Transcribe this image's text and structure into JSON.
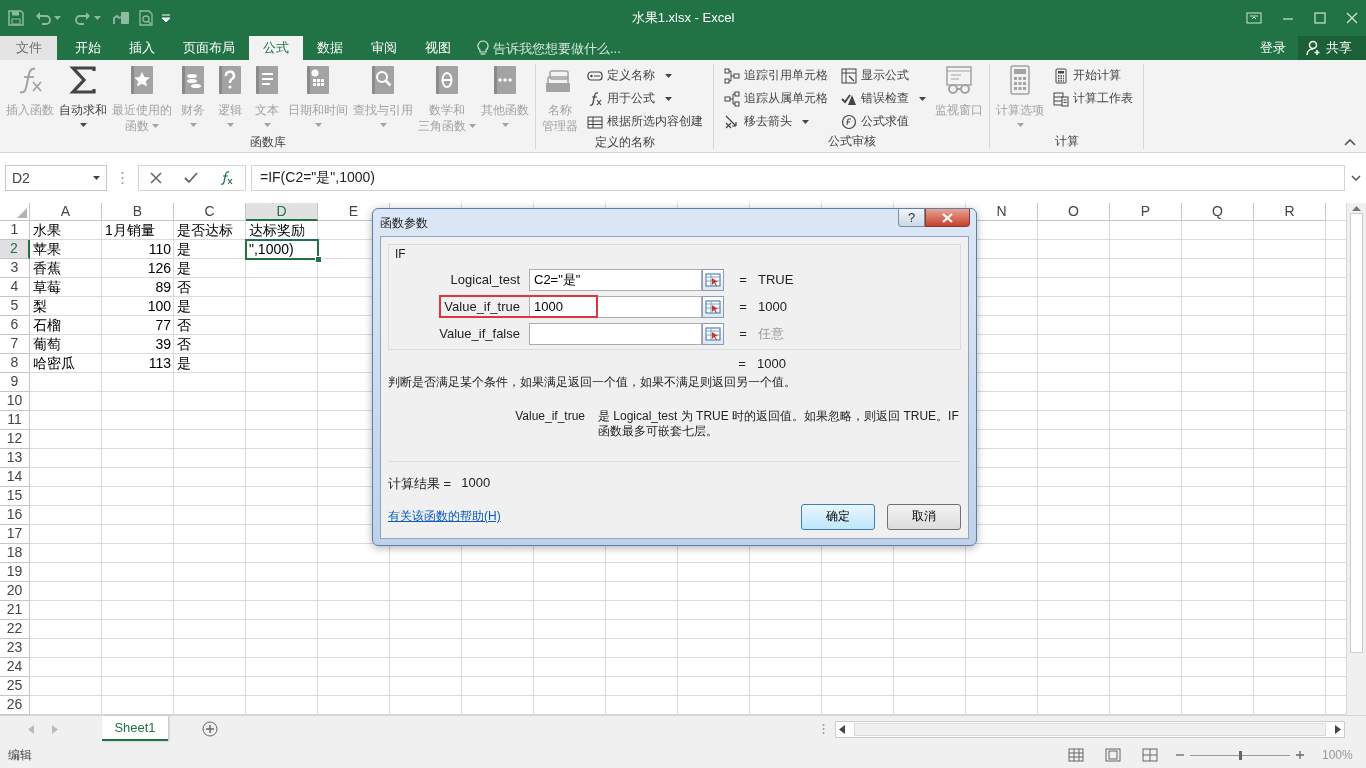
{
  "window": {
    "title": "水果1.xlsx - Excel"
  },
  "tabs": [
    {
      "label": "文件",
      "kind": "file",
      "selected": false
    },
    {
      "label": "开始",
      "kind": "tab",
      "selected": false
    },
    {
      "label": "插入",
      "kind": "tab",
      "selected": false
    },
    {
      "label": "页面布局",
      "kind": "tab",
      "selected": false
    },
    {
      "label": "公式",
      "kind": "tab",
      "selected": true
    },
    {
      "label": "数据",
      "kind": "tab",
      "selected": false
    },
    {
      "label": "审阅",
      "kind": "tab",
      "selected": false
    },
    {
      "label": "视图",
      "kind": "tab",
      "selected": false
    }
  ],
  "tell_me": {
    "placeholder": "告诉我您想要做什么..."
  },
  "account": {
    "sign_in": "登录",
    "share": "共享"
  },
  "ribbon": {
    "groups": [
      {
        "label": "函数库",
        "items": [
          {
            "kind": "large",
            "lines": [
              "插入函数"
            ],
            "disabled": true,
            "dropdown": false
          },
          {
            "kind": "large",
            "lines": [
              "自动求和"
            ],
            "disabled": false,
            "dropdown": true
          },
          {
            "kind": "large",
            "lines": [
              "最近使用的",
              "函数"
            ],
            "disabled": true,
            "dropdown": true
          },
          {
            "kind": "large",
            "lines": [
              "财务"
            ],
            "disabled": true,
            "dropdown": true
          },
          {
            "kind": "large",
            "lines": [
              "逻辑"
            ],
            "disabled": true,
            "dropdown": true
          },
          {
            "kind": "large",
            "lines": [
              "文本"
            ],
            "disabled": true,
            "dropdown": true
          },
          {
            "kind": "large",
            "lines": [
              "日期和时间"
            ],
            "disabled": true,
            "dropdown": true
          },
          {
            "kind": "large",
            "lines": [
              "查找与引用"
            ],
            "disabled": true,
            "dropdown": true
          },
          {
            "kind": "large",
            "lines": [
              "数学和",
              "三角函数"
            ],
            "disabled": true,
            "dropdown": true
          },
          {
            "kind": "large",
            "lines": [
              "其他函数"
            ],
            "disabled": true,
            "dropdown": true
          }
        ]
      },
      {
        "label": "定义的名称",
        "items": [
          {
            "kind": "large",
            "lines": [
              "名称",
              "管理器"
            ],
            "disabled": true,
            "dropdown": false
          },
          {
            "kind": "stack",
            "items": [
              {
                "label": "定义名称",
                "disabled": true,
                "dropdown": true
              },
              {
                "label": "用于公式",
                "disabled": true,
                "dropdown": true
              },
              {
                "label": "根据所选内容创建",
                "disabled": true,
                "dropdown": false
              }
            ]
          }
        ]
      },
      {
        "label": "公式审核",
        "items": [
          {
            "kind": "stack",
            "items": [
              {
                "label": "追踪引用单元格",
                "disabled": true,
                "dropdown": false
              },
              {
                "label": "追踪从属单元格",
                "disabled": true,
                "dropdown": false
              },
              {
                "label": "移去箭头",
                "disabled": true,
                "dropdown": true
              }
            ]
          },
          {
            "kind": "stack",
            "items": [
              {
                "label": "显示公式",
                "disabled": true,
                "dropdown": false
              },
              {
                "label": "错误检查",
                "disabled": true,
                "dropdown": true
              },
              {
                "label": "公式求值",
                "disabled": true,
                "dropdown": false
              }
            ]
          },
          {
            "kind": "large",
            "lines": [
              "监视窗口"
            ],
            "disabled": true,
            "dropdown": false
          }
        ]
      },
      {
        "label": "计算",
        "items": [
          {
            "kind": "large",
            "lines": [
              "计算选项"
            ],
            "disabled": true,
            "dropdown": true
          },
          {
            "kind": "stack",
            "items": [
              {
                "label": "开始计算",
                "disabled": true,
                "dropdown": false
              },
              {
                "label": "计算工作表",
                "disabled": true,
                "dropdown": false
              }
            ]
          }
        ]
      }
    ]
  },
  "formula_bar": {
    "name_box": "D2",
    "formula": "=IF(C2=\"是\",1000)"
  },
  "sheet": {
    "columns": [
      {
        "label": "A",
        "selected": false
      },
      {
        "label": "B",
        "selected": false
      },
      {
        "label": "C",
        "selected": false
      },
      {
        "label": "D",
        "selected": true
      },
      {
        "label": "E",
        "selected": false
      },
      {
        "label": "N",
        "selected": false
      },
      {
        "label": "O",
        "selected": false
      },
      {
        "label": "P",
        "selected": false
      },
      {
        "label": "Q",
        "selected": false
      },
      {
        "label": "R",
        "selected": false
      }
    ],
    "rows": [
      {
        "number": "1",
        "selected": false,
        "cells": [
          {
            "text": "水果",
            "selected": false
          },
          {
            "text": "1月销量",
            "selected": false
          },
          {
            "text": "是否达标",
            "selected": false
          },
          {
            "text": "达标奖励",
            "selected": false
          }
        ]
      },
      {
        "number": "2",
        "selected": true,
        "cells": [
          {
            "text": "苹果",
            "selected": false
          },
          {
            "text": "110",
            "selected": false
          },
          {
            "text": "是",
            "selected": false
          },
          {
            "text": "\",1000)",
            "selected": true
          }
        ]
      },
      {
        "number": "3",
        "selected": false,
        "cells": [
          {
            "text": "香蕉",
            "selected": false
          },
          {
            "text": "126",
            "selected": false
          },
          {
            "text": "是",
            "selected": false
          }
        ]
      },
      {
        "number": "4",
        "selected": false,
        "cells": [
          {
            "text": "草莓",
            "selected": false
          },
          {
            "text": "89",
            "selected": false
          },
          {
            "text": "否",
            "selected": false
          }
        ]
      },
      {
        "number": "5",
        "selected": false,
        "cells": [
          {
            "text": "梨",
            "selected": false
          },
          {
            "text": "100",
            "selected": false
          },
          {
            "text": "是",
            "selected": false
          }
        ]
      },
      {
        "number": "6",
        "selected": false,
        "cells": [
          {
            "text": "石榴",
            "selected": false
          },
          {
            "text": "77",
            "selected": false
          },
          {
            "text": "否",
            "selected": false
          }
        ]
      },
      {
        "number": "7",
        "selected": false,
        "cells": [
          {
            "text": "葡萄",
            "selected": false
          },
          {
            "text": "39",
            "selected": false
          },
          {
            "text": "否",
            "selected": false
          }
        ]
      },
      {
        "number": "8",
        "selected": false,
        "cells": [
          {
            "text": "哈密瓜",
            "selected": false
          },
          {
            "text": "113",
            "selected": false
          },
          {
            "text": "是",
            "selected": false
          }
        ]
      },
      {
        "number": "9",
        "selected": false
      },
      {
        "number": "10",
        "selected": false
      },
      {
        "number": "11",
        "selected": false
      },
      {
        "number": "12",
        "selected": false
      },
      {
        "number": "13",
        "selected": false
      },
      {
        "number": "14",
        "selected": false
      },
      {
        "number": "15",
        "selected": false
      },
      {
        "number": "16",
        "selected": false
      },
      {
        "number": "17",
        "selected": false
      },
      {
        "number": "18",
        "selected": false
      },
      {
        "number": "19",
        "selected": false
      },
      {
        "number": "20",
        "selected": false
      },
      {
        "number": "21",
        "selected": false
      },
      {
        "number": "22",
        "selected": false
      },
      {
        "number": "23",
        "selected": false
      },
      {
        "number": "24",
        "selected": false
      },
      {
        "number": "25",
        "selected": false
      },
      {
        "number": "26",
        "selected": false
      }
    ]
  },
  "sheet_tabs": [
    {
      "label": "Sheet1",
      "selected": true
    }
  ],
  "status_bar": {
    "mode": "编辑",
    "zoom": "100%",
    "zoom_slider": {
      "level": 0.5
    }
  },
  "dialog": {
    "title": "函数参数",
    "help_button": "?",
    "function_name": "IF",
    "arguments": [
      {
        "label": "Logical_test",
        "value": "C2=\"是\"",
        "equals": "=",
        "result": "TRUE",
        "dimmed": false,
        "highlighted": false
      },
      {
        "label": "Value_if_true",
        "value": "1000",
        "equals": "=",
        "result": "1000",
        "dimmed": false,
        "highlighted": true
      },
      {
        "label": "Value_if_false",
        "equals": "=",
        "result": "任意",
        "dimmed": true,
        "highlighted": false
      }
    ],
    "formula_result": {
      "equals": "=",
      "value": "1000"
    },
    "description": "判断是否满足某个条件，如果满足返回一个值，如果不满足则返回另一个值。",
    "argument_help": {
      "name": "Value_if_true",
      "text": "是 Logical_test 为 TRUE 时的返回值。如果忽略，则返回 TRUE。IF 函数最多可嵌套七层。"
    },
    "calc_result": {
      "label": "计算结果 =",
      "value": "1000"
    },
    "help_link": "有关该函数的帮助(H)",
    "buttons": [
      {
        "label": "确定",
        "default": true
      },
      {
        "label": "取消",
        "default": false
      }
    ]
  }
}
